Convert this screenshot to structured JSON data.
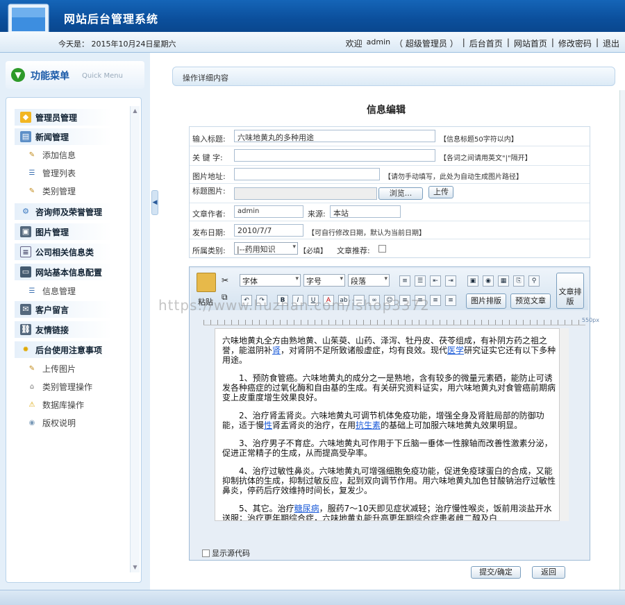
{
  "header": {
    "title": "网站后台管理系统"
  },
  "subbar": {
    "date": "今天是： 2015年10月24日星期六",
    "welcome": "欢迎",
    "user": "admin",
    "role": "（ 超级管理员 ）",
    "links": [
      "后台首页",
      "网站首页",
      "修改密码",
      "退出"
    ]
  },
  "menu": {
    "title": "功能菜单",
    "subtitle": "Quick Menu",
    "groups": [
      {
        "label": "管理员管理",
        "icon": "shield-icon"
      },
      {
        "label": "新闻管理",
        "icon": "news-icon",
        "items": [
          "添加信息",
          "管理列表",
          "类别管理"
        ]
      },
      {
        "label": "咨询师及荣誉管理",
        "icon": "gear-icon"
      },
      {
        "label": "图片管理",
        "icon": "picture-icon"
      },
      {
        "label": "公司相关信息类",
        "icon": "document-icon"
      },
      {
        "label": "网站基本信息配置",
        "icon": "computer-icon",
        "items": [
          "信息管理"
        ]
      },
      {
        "label": "客户留言",
        "icon": "message-icon"
      },
      {
        "label": "友情链接",
        "icon": "link-icon"
      },
      {
        "label": "后台使用注意事项",
        "icon": "bulb-icon",
        "items": [
          "上传图片",
          "类别管理操作",
          "数据库操作",
          "版权说明"
        ]
      }
    ]
  },
  "main": {
    "header": "操作详细内容",
    "page_title": "信息编辑",
    "form": {
      "title_label": "输入标题:",
      "title_value": "六味地黄丸的多种用途",
      "title_note": "【信息标题50字符以内】",
      "keyword_label": "关 键 字:",
      "keyword_note": "【各词之间请用英文\"|\"隔开】",
      "imgurl_label": "图片地址:",
      "imgurl_note": "【请勿手动填写，此处为自动生成图片路径】",
      "titleimg_label": "标题图片:",
      "browse": "浏览...",
      "upload": "上传",
      "author_label": "文章作者:",
      "author_value": "admin",
      "source_label": "来源:",
      "source_value": "本站",
      "date_label": "发布日期:",
      "date_value": "2010/7/7",
      "date_note": "【可自行修改日期，默认为当前日期】",
      "category_label": "所属类别:",
      "category_value": "|--药用知识",
      "required_note": "【必填】",
      "recommend_label": "文章推荐:"
    },
    "editor": {
      "paste": "粘贴",
      "font": "字体",
      "size": "字号",
      "para": "段落",
      "img_layout": "图片排版",
      "preview": "预览文章",
      "article_layout": "文章排版",
      "ruler_label": "550px",
      "show_source": "显示源代码",
      "watermark": "https://www.huzhan.com/ishop3372",
      "paragraphs": [
        {
          "parts": [
            {
              "t": "六味地黄丸全方由熟地黄、山茱萸、山药、泽泻、牡丹皮、茯苓组成，有补阴方药之祖之誉，能滋阴补"
            },
            {
              "t": "肾",
              "link": true
            },
            {
              "t": "，对肾阴不足所致诸般虚症，均有良效。现代"
            },
            {
              "t": "医学",
              "link": true
            },
            {
              "t": "研究证实它还有以下多种用途。"
            }
          ]
        },
        {
          "parts": [
            {
              "t": "　　1、预防食管癌。六味地黄丸的成分之一是熟地，含有较多的微量元素硒，能防止可诱发各种癌症的过氧化酶和自由基的生成。有关研究资料证实，用六味地黄丸对食管癌前期病变上皮重度增生效果良好。"
            }
          ]
        },
        {
          "parts": [
            {
              "t": "　　2、治疗肾盂肾炎。六味地黄丸可调节机体免疫功能，增强全身及肾脏局部的防御功能，适于慢"
            },
            {
              "t": "性",
              "link": true
            },
            {
              "t": "肾盂肾炎的治疗，在用"
            },
            {
              "t": "抗生素",
              "link": true
            },
            {
              "t": "的基础上可加服六味地黄丸效果明显。"
            }
          ]
        },
        {
          "parts": [
            {
              "t": "　　3、治疗男子不育症。六味地黄丸可作用于下丘脑一垂体一性腺轴而改善性激素分泌，促进正常精子的生成，从而提高受孕率。"
            }
          ]
        },
        {
          "parts": [
            {
              "t": "　　4、治疗过敏性鼻炎。六味地黄丸可增强细胞免疫功能，促进免疫球蛋白的合成，又能抑制抗体的生成，抑制过敏反应，起到双向调节作用。用六味地黄丸加色甘酸钠治疗过敏性鼻炎，停药后疗效维持时间长，复发少。"
            }
          ]
        },
        {
          "parts": [
            {
              "t": "　　5、其它。治疗"
            },
            {
              "t": "糖尿病",
              "link": true
            },
            {
              "t": "，服药7～10天即见症状减轻；治疗慢性喉炎，饭前用淡盐开水送服；治疗更年期综合症，六味地黄丸能升高更年期综合症患者雌二醇及白"
            }
          ]
        }
      ]
    },
    "submit": "提交/确定",
    "back": "返回"
  }
}
